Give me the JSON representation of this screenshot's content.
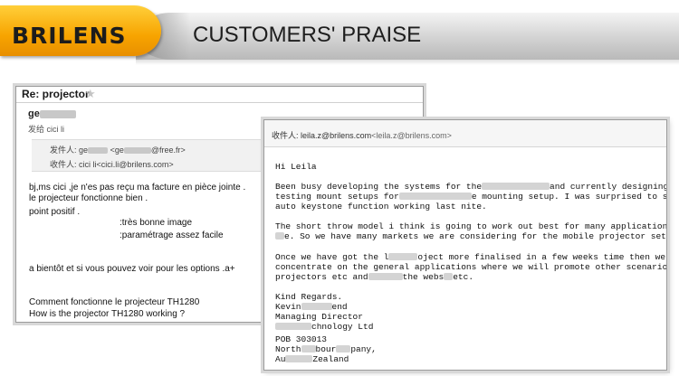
{
  "banner": {
    "brand": "BRILENS",
    "title": "CUSTOMERS' PRAISE"
  },
  "email_fr": {
    "subject": "Re: projector",
    "sender_name": "ge",
    "sent_to": "发给 cici li",
    "from_label": "发件人:",
    "from_name": "ge",
    "from_addr_start": "<ge",
    "from_domain": "@free.fr>",
    "to_line": "收件人: cici li<cici.li@brilens.com>",
    "body": [
      "bj,ms cici ,je n'es pas reçu ma facture en pièce jointe .",
      "le projecteur fonctionne bien .",
      "point positif  .",
      ":très bonne image",
      ":paramétrage assez facile",
      "a bientôt et si vous pouvez voir pour les options .a+",
      "Comment fonctionne le projecteur TH1280",
      "How is the projector TH1280 working ?"
    ]
  },
  "email_en": {
    "recipient_label": "收件人: leila.z@brilens.com",
    "recipient_addr": "<leila.z@brilens.com>",
    "greeting": "Hi Leila",
    "p1_l1_a": "Been busy developing the systems for the",
    "p1_l1_b": "and currently designing and",
    "p1_l2_a": "testing mount setups for",
    "p1_l2_b": "e mounting setup. I was surprised to see the",
    "p1_l3": "auto keystone function working last nite.",
    "p2_l1": "The short throw model i think is going to work out best for many applications on the",
    "p2_l2": "e.  So we have many markets we are considering for the mobile projector setup.",
    "p3_l1_a": "Once we have got the l",
    "p3_l1_b": "oject more finalised in a few weeks time then we can",
    "p3_l2": "concentrate on the general applications where we will promote other scenarios for the",
    "p3_l3_a": "projectors etc and",
    "p3_l3_b": "the webs",
    "p3_l3_c": "etc.",
    "sign_1": "Kind Regards.",
    "sign_2a": "Kevin",
    "sign_2b": "end",
    "sign_3": "Managing Director",
    "sign_4": "chnology Ltd",
    "sign_5": "POB 303013",
    "sign_6a": "North",
    "sign_6b": "bour",
    "sign_6c": "pany,",
    "sign_7a": "Au",
    "sign_7b": "Zealand"
  }
}
